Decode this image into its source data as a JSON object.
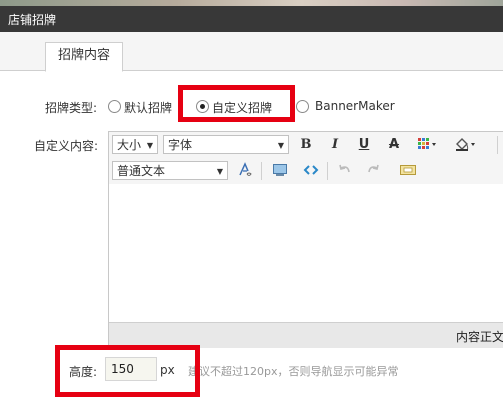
{
  "window": {
    "title": "店铺招牌"
  },
  "tabs": [
    {
      "label": "招牌内容"
    }
  ],
  "sign_type": {
    "label": "招牌类型:",
    "options": [
      {
        "label": "默认招牌",
        "checked": false
      },
      {
        "label": "自定义招牌",
        "checked": true
      },
      {
        "label": "BannerMaker",
        "checked": false
      }
    ]
  },
  "custom_content": {
    "label": "自定义内容:"
  },
  "editor": {
    "size_select": "大小",
    "font_select": "字体",
    "bold": "B",
    "italic": "I",
    "underline": "U",
    "strike": "A",
    "format_select": "普通文本",
    "status_text": "内容正文"
  },
  "height": {
    "label": "高度:",
    "value": "150",
    "unit": "px",
    "hint": "建议不超过120px，否则导航显示可能异常"
  },
  "colors": {
    "highlight": "#e60012",
    "titlebar": "#383838"
  }
}
